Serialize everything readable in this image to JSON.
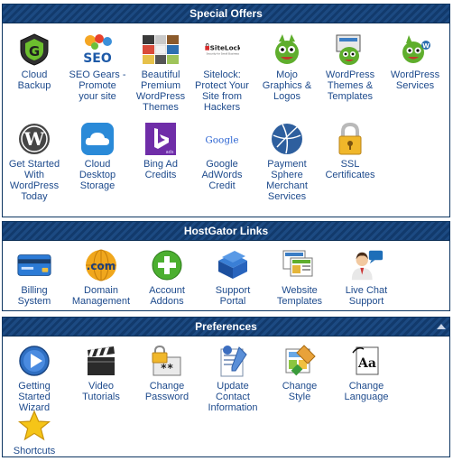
{
  "sections": {
    "special_offers": {
      "title": "Special Offers",
      "items": [
        {
          "label": "Cloud Backup",
          "icon": "cloud-backup-icon"
        },
        {
          "label": "SEO Gears - Promote your site",
          "icon": "seo-gears-icon",
          "icon_text": "SEO"
        },
        {
          "label": "Beautiful Premium WordPress Themes",
          "icon": "themes-collage-icon"
        },
        {
          "label": "Sitelock: Protect Your Site from Hackers",
          "icon": "sitelock-icon",
          "icon_text": "SiteLock",
          "icon_subtext": "Security for Small Business"
        },
        {
          "label": "Mojo Graphics & Logos",
          "icon": "mojo-mascot-icon"
        },
        {
          "label": "WordPress Themes & Templates",
          "icon": "mojo-themes-icon"
        },
        {
          "label": "WordPress Services",
          "icon": "mojo-services-icon"
        },
        {
          "label": "Get Started With WordPress Today",
          "icon": "wordpress-icon"
        },
        {
          "label": "Cloud Desktop Storage",
          "icon": "cloud-storage-icon"
        },
        {
          "label": "Bing Ad Credits",
          "icon": "bing-icon",
          "icon_text": "ads"
        },
        {
          "label": "Google AdWords Credit",
          "icon": "google-icon",
          "icon_text": "Google"
        },
        {
          "label": "Payment Sphere Merchant Services",
          "icon": "payment-sphere-icon"
        },
        {
          "label": "SSL Certificates",
          "icon": "padlock-icon"
        }
      ]
    },
    "hostgator_links": {
      "title": "HostGator Links",
      "items": [
        {
          "label": "Billing System",
          "icon": "credit-card-icon"
        },
        {
          "label": "Domain Management",
          "icon": "dotcom-globe-icon",
          "icon_text": ".com"
        },
        {
          "label": "Account Addons",
          "icon": "add-plus-icon"
        },
        {
          "label": "Support Portal",
          "icon": "support-books-icon"
        },
        {
          "label": "Website Templates",
          "icon": "templates-icon"
        },
        {
          "label": "Live Chat Support",
          "icon": "live-chat-icon"
        }
      ]
    },
    "preferences": {
      "title": "Preferences",
      "items": [
        {
          "label": "Getting Started Wizard",
          "icon": "play-wizard-icon"
        },
        {
          "label": "Video Tutorials",
          "icon": "clapperboard-icon"
        },
        {
          "label": "Change Password",
          "icon": "password-lock-icon",
          "icon_text": "**"
        },
        {
          "label": "Update Contact Information",
          "icon": "contact-info-icon"
        },
        {
          "label": "Change Style",
          "icon": "change-style-icon"
        },
        {
          "label": "Change Language",
          "icon": "change-language-icon",
          "icon_text": "Aa"
        },
        {
          "label": "Shortcuts",
          "icon": "star-icon"
        }
      ]
    }
  },
  "colors": {
    "header_dark": "#123a6c",
    "header_light": "#1c4a82",
    "link_text": "#1d4a8c"
  }
}
